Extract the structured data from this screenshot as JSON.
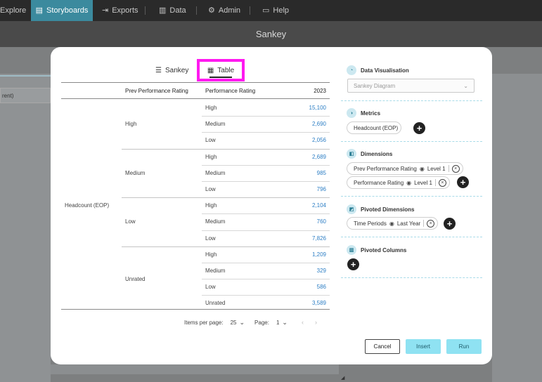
{
  "topnav": {
    "items": [
      {
        "label": "Explore",
        "icon": "explore-icon"
      },
      {
        "label": "Storyboards",
        "icon": "storyboard-icon",
        "active": true
      },
      {
        "label": "Exports",
        "icon": "export-icon"
      },
      {
        "label": "Data",
        "icon": "data-icon"
      },
      {
        "label": "Admin",
        "icon": "gear-icon"
      },
      {
        "label": "Help",
        "icon": "help-icon"
      }
    ]
  },
  "page_title": "Sankey",
  "backdrop": {
    "field_text": "rent)"
  },
  "modal": {
    "tabs": [
      {
        "label": "Sankey",
        "icon": "sankey-icon"
      },
      {
        "label": "Table",
        "icon": "table-icon",
        "active": true,
        "highlighted": true
      }
    ],
    "table": {
      "headers": {
        "metric": "",
        "prev": "Prev Performance Rating",
        "perf": "Performance Rating",
        "year": "2023"
      },
      "metric_label": "Headcount (EOP)",
      "groups": [
        {
          "prev": "High",
          "rows": [
            {
              "perf": "High",
              "value": "15,100"
            },
            {
              "perf": "Medium",
              "value": "2,690"
            },
            {
              "perf": "Low",
              "value": "2,056"
            }
          ]
        },
        {
          "prev": "Medium",
          "rows": [
            {
              "perf": "High",
              "value": "2,689"
            },
            {
              "perf": "Medium",
              "value": "985"
            },
            {
              "perf": "Low",
              "value": "796"
            }
          ]
        },
        {
          "prev": "Low",
          "rows": [
            {
              "perf": "High",
              "value": "2,104"
            },
            {
              "perf": "Medium",
              "value": "760"
            },
            {
              "perf": "Low",
              "value": "7,826"
            }
          ]
        },
        {
          "prev": "Unrated",
          "rows": [
            {
              "perf": "High",
              "value": "1,209"
            },
            {
              "perf": "Medium",
              "value": "329"
            },
            {
              "perf": "Low",
              "value": "586"
            },
            {
              "perf": "Unrated",
              "value": "3,589"
            }
          ]
        }
      ]
    },
    "pagination": {
      "items_per_page_label": "Items per page:",
      "items_per_page": "25",
      "page_label": "Page:",
      "page": "1"
    },
    "panel": {
      "data_vis": {
        "title": "Data Visualisation",
        "select_value": "Sankey Diagram"
      },
      "metrics": {
        "title": "Metrics",
        "items": [
          "Headcount (EOP)"
        ]
      },
      "dimensions": {
        "title": "Dimensions",
        "items": [
          {
            "label": "Prev Performance Rating",
            "level": "Level 1"
          },
          {
            "label": "Performance Rating",
            "level": "Level 1"
          }
        ]
      },
      "pivoted_dimensions": {
        "title": "Pivoted Dimensions",
        "items": [
          {
            "label": "Time Periods",
            "level": "Last Year"
          }
        ]
      },
      "pivoted_columns": {
        "title": "Pivoted Columns"
      }
    },
    "buttons": {
      "cancel": "Cancel",
      "insert": "Insert",
      "run": "Run"
    }
  },
  "colors": {
    "accent": "#8fe2f2",
    "highlight": "#ff19f0",
    "value_link": "#2e7fc5",
    "nav_active": "#3b8a9e"
  }
}
